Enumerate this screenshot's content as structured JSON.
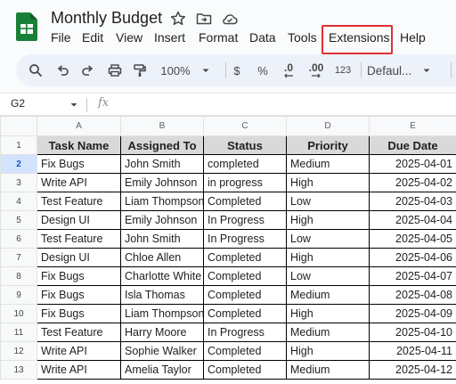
{
  "app": {
    "title": "Monthly Budget",
    "accent": "#188038",
    "highlight_color": "#e03030"
  },
  "title_icons": [
    "star-icon",
    "move-to-folder-icon",
    "cloud-status-icon"
  ],
  "menu": [
    "File",
    "Edit",
    "View",
    "Insert",
    "Format",
    "Data",
    "Tools",
    "Extensions",
    "Help"
  ],
  "toolbar": {
    "zoom": "100%",
    "currency": "$",
    "percent": "%",
    "dec_decrease": ".0",
    "dec_increase": ".00",
    "more_formats": "123",
    "font": "Defaul..."
  },
  "formula_bar": {
    "cell_ref": "G2",
    "fx": "fx"
  },
  "sheet": {
    "columns": [
      "A",
      "B",
      "C",
      "D",
      "E"
    ],
    "headers": [
      "Task Name",
      "Assigned To",
      "Status",
      "Priority",
      "Due Date"
    ],
    "rows": [
      [
        "Fix Bugs",
        "John Smith",
        "completed",
        "Medium",
        "2025-04-01"
      ],
      [
        "Write API",
        "Emily Johnson",
        "in progress",
        "High",
        "2025-04-02"
      ],
      [
        "Test Feature",
        "Liam Thompson",
        "Completed",
        "Low",
        "2025-04-03"
      ],
      [
        "Design UI",
        "Emily Johnson",
        "In Progress",
        "High",
        "2025-04-04"
      ],
      [
        "Test Feature",
        "John Smith",
        "In Progress",
        "Low",
        "2025-04-05"
      ],
      [
        "Design UI",
        "Chloe Allen",
        "Completed",
        "High",
        "2025-04-06"
      ],
      [
        "Fix Bugs",
        "Charlotte White",
        "Completed",
        "Low",
        "2025-04-07"
      ],
      [
        "Fix Bugs",
        "Isla Thomas",
        "Completed",
        "Medium",
        "2025-04-08"
      ],
      [
        "Fix Bugs",
        "Liam Thompson",
        "Completed",
        "High",
        "2025-04-09"
      ],
      [
        "Test Feature",
        "Harry Moore",
        "In Progress",
        "Medium",
        "2025-04-10"
      ],
      [
        "Write API",
        "Sophie Walker",
        "Completed",
        "High",
        "2025-04-11"
      ],
      [
        "Write API",
        "Amelia Taylor",
        "Completed",
        "Medium",
        "2025-04-12"
      ]
    ],
    "selected_row_header": "2"
  }
}
